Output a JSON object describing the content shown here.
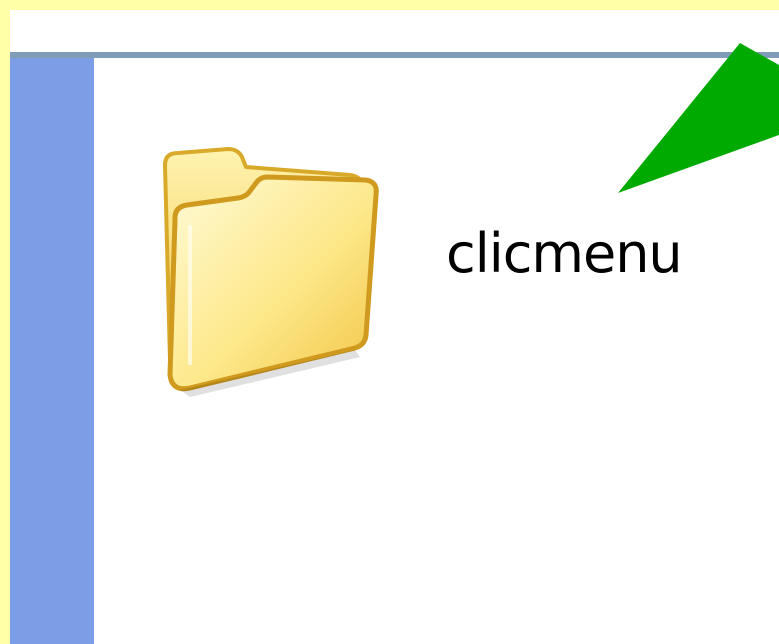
{
  "window": {
    "title": ""
  },
  "folder": {
    "name": "clicmenu",
    "icon": "folder-icon"
  },
  "annotation": {
    "icon": "green-arrow-icon",
    "color": "#00aa00"
  },
  "colors": {
    "background": "#ffffa8",
    "side_panel": "#7b9ee6",
    "divider": "#7f9db9",
    "content": "#ffffff"
  }
}
